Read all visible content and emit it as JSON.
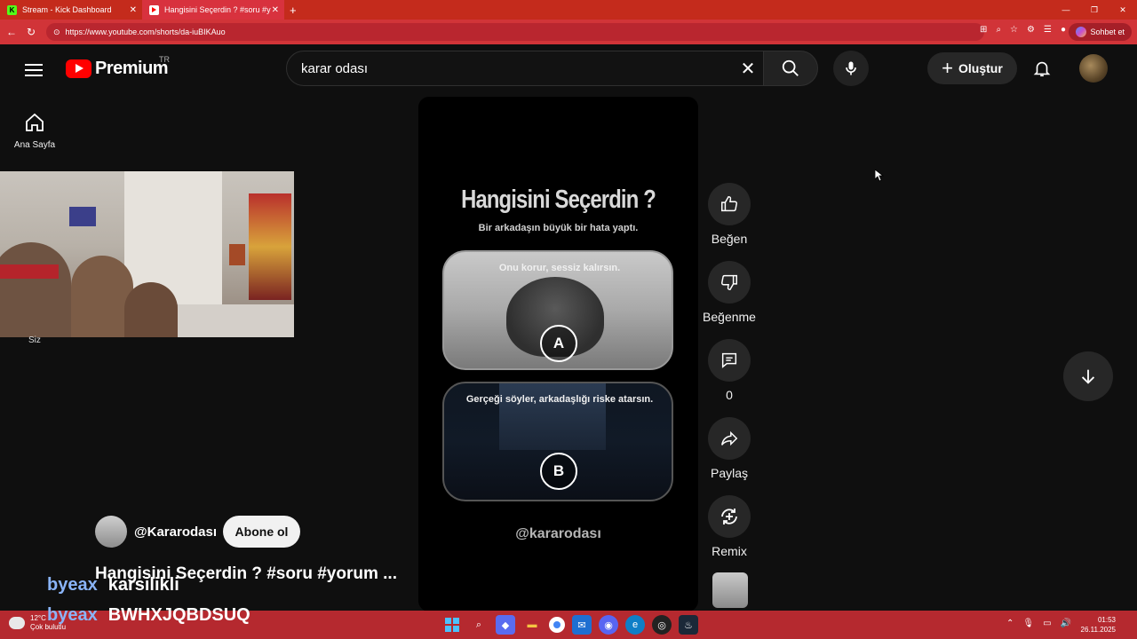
{
  "browser": {
    "tabs": [
      {
        "title": "Stream - Kick Dashboard",
        "icon": "kick-icon"
      },
      {
        "title": "Hangisini Seçerdin ? #soru #yorun",
        "icon": "youtube-icon"
      }
    ],
    "url": "https://www.youtube.com/shorts/da-iuBIKAuo",
    "chat_button": "Sohbet et"
  },
  "youtube": {
    "logo_text": "Premium",
    "region": "TR",
    "search_value": "karar odası",
    "create_label": "Oluştur",
    "sidebar": {
      "home_label": "Ana Sayfa"
    }
  },
  "webcam": {
    "label": "Siz"
  },
  "short": {
    "title": "Hangisini Seçerdin ?",
    "subtitle": "Bir arkadaşın büyük bir hata yaptı.",
    "option_a": {
      "text": "Onu korur, sessiz kalırsın.",
      "badge": "A"
    },
    "option_b": {
      "text": "Gerçeği söyler, arkadaşlığı riske atarsın.",
      "badge": "B"
    },
    "handle": "@kararodası"
  },
  "actions": {
    "like": "Beğen",
    "dislike": "Beğenme",
    "comments": "0",
    "share": "Paylaş",
    "remix": "Remix"
  },
  "channel": {
    "name": "@Kararodası",
    "subscribe": "Abone ol",
    "video_title": "Hangisini Seçerdin ? #soru #yorum ..."
  },
  "stream_chat": [
    {
      "user": "byeax",
      "message": "karsilikli"
    },
    {
      "user": "byeax",
      "message": "BWHXJQBDSUQ"
    }
  ],
  "taskbar": {
    "temp": "12°C",
    "weather": "Çok bulutlu",
    "time": "01:53",
    "date": "26.11.2025"
  }
}
